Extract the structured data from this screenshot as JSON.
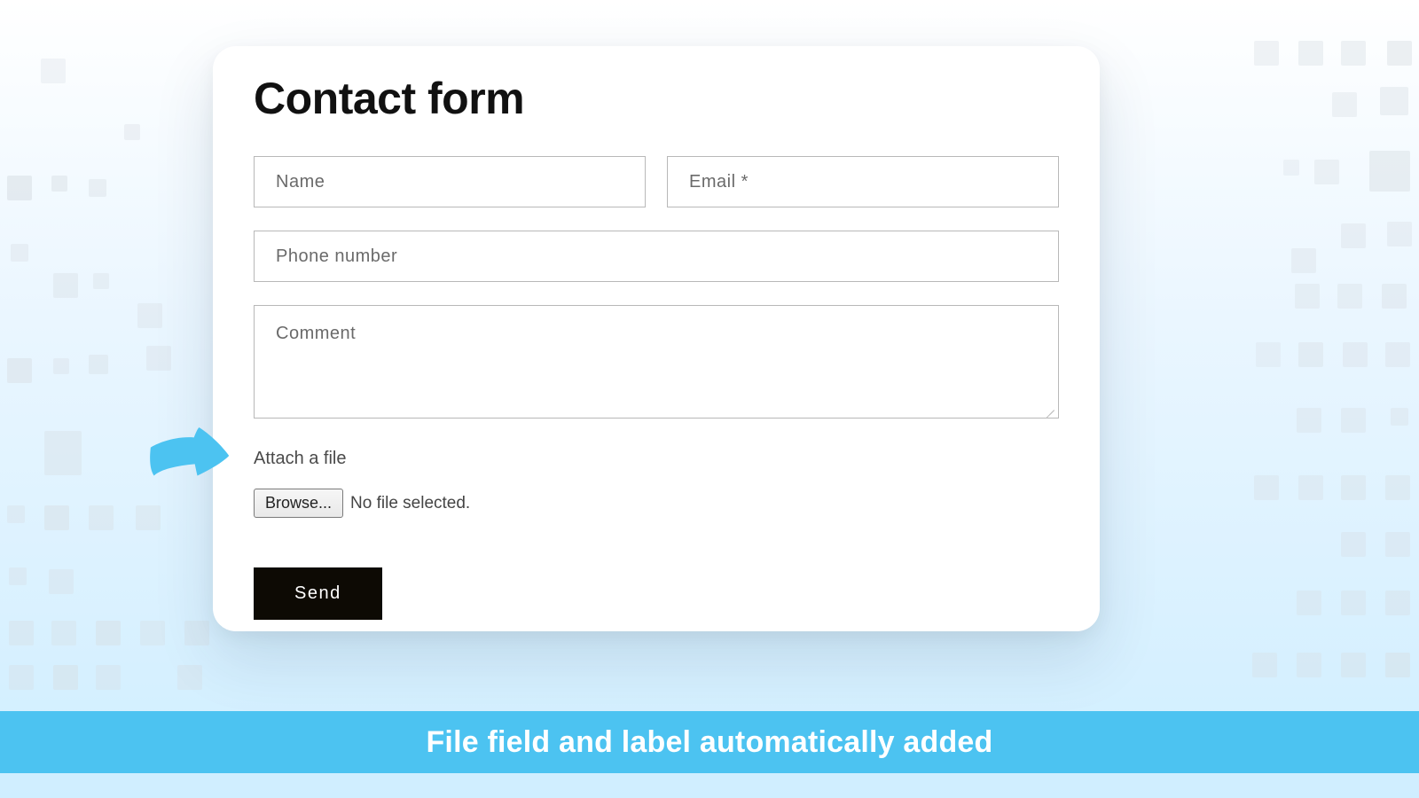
{
  "form": {
    "title": "Contact form",
    "name_placeholder": "Name",
    "email_placeholder": "Email *",
    "phone_placeholder": "Phone number",
    "comment_placeholder": "Comment",
    "attach_label": "Attach a file",
    "browse_label": "Browse...",
    "file_status": "No file selected.",
    "send_label": "Send"
  },
  "banner": {
    "text": "File field and label automatically added"
  }
}
